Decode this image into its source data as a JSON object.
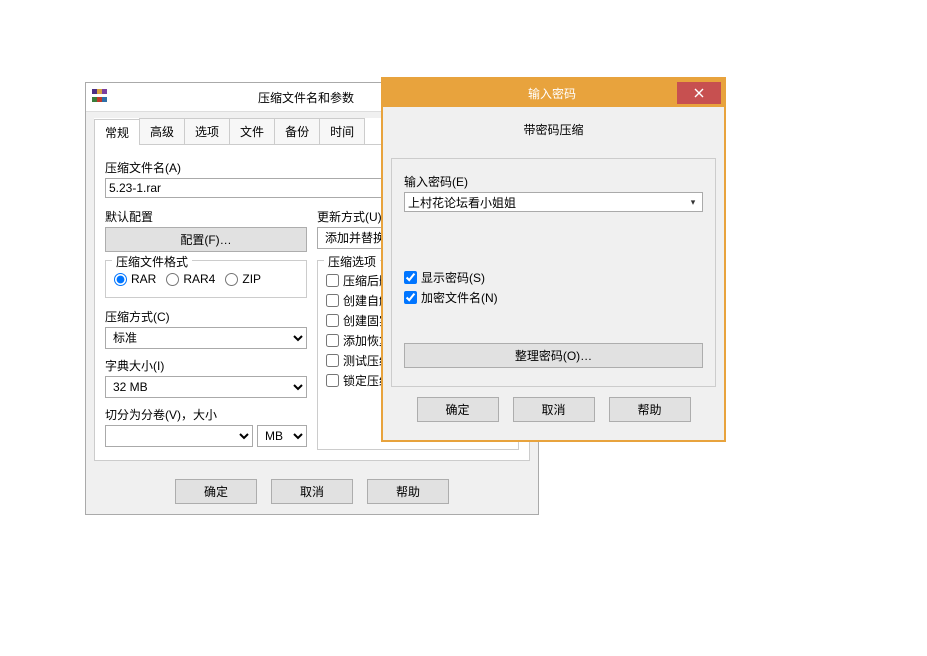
{
  "main": {
    "title": "压缩文件名和参数",
    "tabs": [
      "常规",
      "高级",
      "选项",
      "文件",
      "备份",
      "时间"
    ],
    "archive_name_label": "压缩文件名(A)",
    "archive_name_value": "5.23-1.rar",
    "default_profile_label": "默认配置",
    "profiles_btn": "配置(F)…",
    "update_mode_label": "更新方式(U)",
    "update_mode_value": "添加并替换文",
    "format_label": "压缩文件格式",
    "format_options": [
      "RAR",
      "RAR4",
      "ZIP"
    ],
    "method_label": "压缩方式(C)",
    "method_value": "标准",
    "dict_label": "字典大小(I)",
    "dict_value": "32 MB",
    "vol_label": "切分为分卷(V)，大小",
    "vol_unit": "MB",
    "compress_options_label": "压缩选项",
    "opts": [
      "压缩后删",
      "创建自解",
      "创建固实",
      "添加恢复",
      "测试压缩",
      "锁定压缩"
    ],
    "ok": "确定",
    "cancel": "取消",
    "help": "帮助"
  },
  "pwd": {
    "title": "输入密码",
    "subtitle": "带密码压缩",
    "enter_label": "输入密码(E)",
    "value": "上村花论坛看小姐姐",
    "show_pwd": "显示密码(S)",
    "encrypt_names": "加密文件名(N)",
    "organize_btn": "整理密码(O)…",
    "ok": "确定",
    "cancel": "取消",
    "help": "帮助"
  }
}
